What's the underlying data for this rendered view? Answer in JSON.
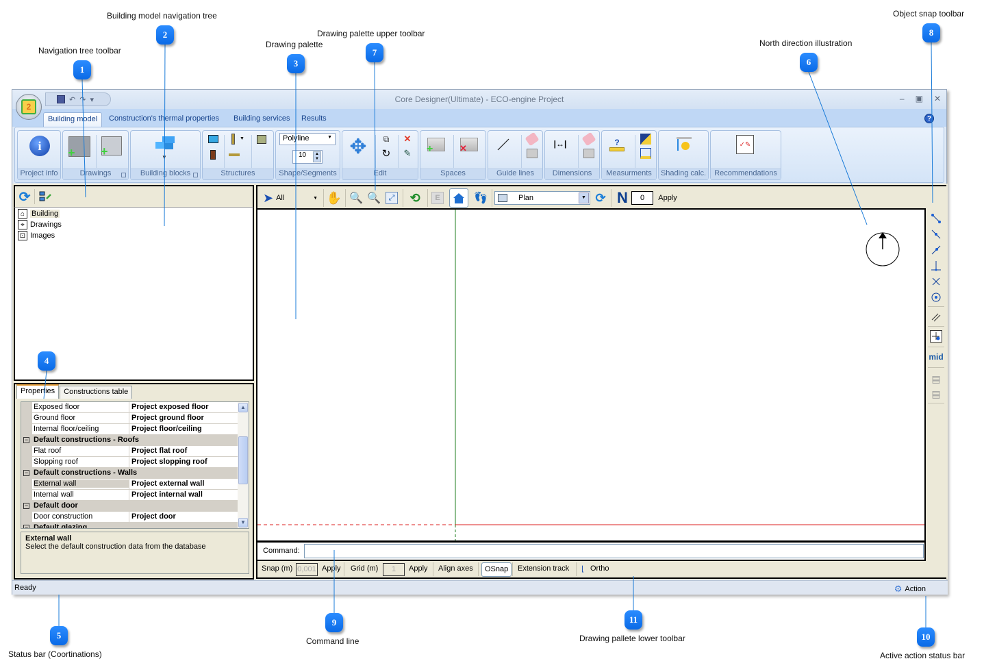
{
  "annotations": [
    {
      "num": "1",
      "label": "Navigation tree toolbar"
    },
    {
      "num": "2",
      "label": "Building model navigation tree"
    },
    {
      "num": "3",
      "label": "Drawing palette"
    },
    {
      "num": "4",
      "label": "Properties tab"
    },
    {
      "num": "5",
      "label": "Status bar (Coortinations)"
    },
    {
      "num": "6",
      "label": "North direction illustration"
    },
    {
      "num": "7",
      "label": "Drawing palette upper toolbar"
    },
    {
      "num": "8",
      "label": "Object snap toolbar"
    },
    {
      "num": "9",
      "label": "Command line"
    },
    {
      "num": "10",
      "label": "Active action status bar"
    },
    {
      "num": "11",
      "label": "Drawing pallete lower toolbar"
    }
  ],
  "window": {
    "title": "Core Designer(Ultimate) - ECO-engine Project",
    "orb_badge": "2",
    "qat": {
      "save": "save-icon",
      "undo": "↶",
      "redo": "↷",
      "customize": "▾"
    },
    "buttons": {
      "minimize": "–",
      "restore": "▣",
      "close": "✕"
    },
    "help": "?"
  },
  "ribbon": {
    "tabs": [
      {
        "label": "Building model",
        "active": true
      },
      {
        "label": "Construction's thermal properties"
      },
      {
        "label": "Building services"
      },
      {
        "label": "Results"
      }
    ],
    "groups": {
      "project_info": "Project info",
      "drawings": "Drawings",
      "building_blocks": "Building blocks",
      "structures": "Structures",
      "shape_segments": "Shape/Segments",
      "edit": "Edit",
      "spaces": "Spaces",
      "guide_lines": "Guide lines",
      "dimensions": "Dimensions",
      "measurments": "Measurments",
      "shading_calc": "Shading calc.",
      "recommendations": "Recommendations"
    },
    "shape_combo": "Polyline",
    "segments_value": "10"
  },
  "nav_tree": {
    "items": [
      {
        "label": "Building",
        "icon": "house-icon",
        "selected": true
      },
      {
        "label": "Drawings",
        "icon": "drawing-icon"
      },
      {
        "label": "Images",
        "icon": "images-icon"
      }
    ]
  },
  "properties": {
    "tabs": [
      "Properties",
      "Constructions table"
    ],
    "rows": [
      {
        "type": "item",
        "key": "Exposed floor",
        "value": "Project exposed floor"
      },
      {
        "type": "item",
        "key": "Ground floor",
        "value": "Project ground floor"
      },
      {
        "type": "item",
        "key": "Internal floor/ceiling",
        "value": "Project floor/ceiling"
      },
      {
        "type": "cat",
        "key": "Default constructions - Roofs"
      },
      {
        "type": "item",
        "key": "Flat roof",
        "value": "Project flat roof"
      },
      {
        "type": "item",
        "key": "Slopping roof",
        "value": "Project slopping roof"
      },
      {
        "type": "cat",
        "key": "Default constructions - Walls"
      },
      {
        "type": "item",
        "key": "External wall",
        "value": "Project external wall",
        "selected": true
      },
      {
        "type": "item",
        "key": "Internal wall",
        "value": "Project internal wall"
      },
      {
        "type": "cat",
        "key": "Default door"
      },
      {
        "type": "item",
        "key": "Door construction",
        "value": "Project door"
      },
      {
        "type": "cat",
        "key": "Default glazing"
      }
    ],
    "description_title": "External wall",
    "description_text": "Select the default construction data from the database"
  },
  "draw_toolbar": {
    "select_filter": "All",
    "view_combo": "Plan",
    "north_label": "N",
    "north_angle": "0",
    "apply": "Apply"
  },
  "command": {
    "label": "Command:",
    "value": ""
  },
  "lower_toolbar": {
    "snap_label": "Snap (m)",
    "snap_value": "0,001",
    "snap_apply": "Apply",
    "grid_label": "Grid (m)",
    "grid_value": "1",
    "grid_apply": "Apply",
    "align_axes": "Align axes",
    "osnap": "OSnap",
    "extension_track": "Extension track",
    "ortho": "Ortho"
  },
  "snap_toolbar": {
    "mid_label": "mid"
  },
  "status": {
    "left": "Ready",
    "action": "Action"
  }
}
